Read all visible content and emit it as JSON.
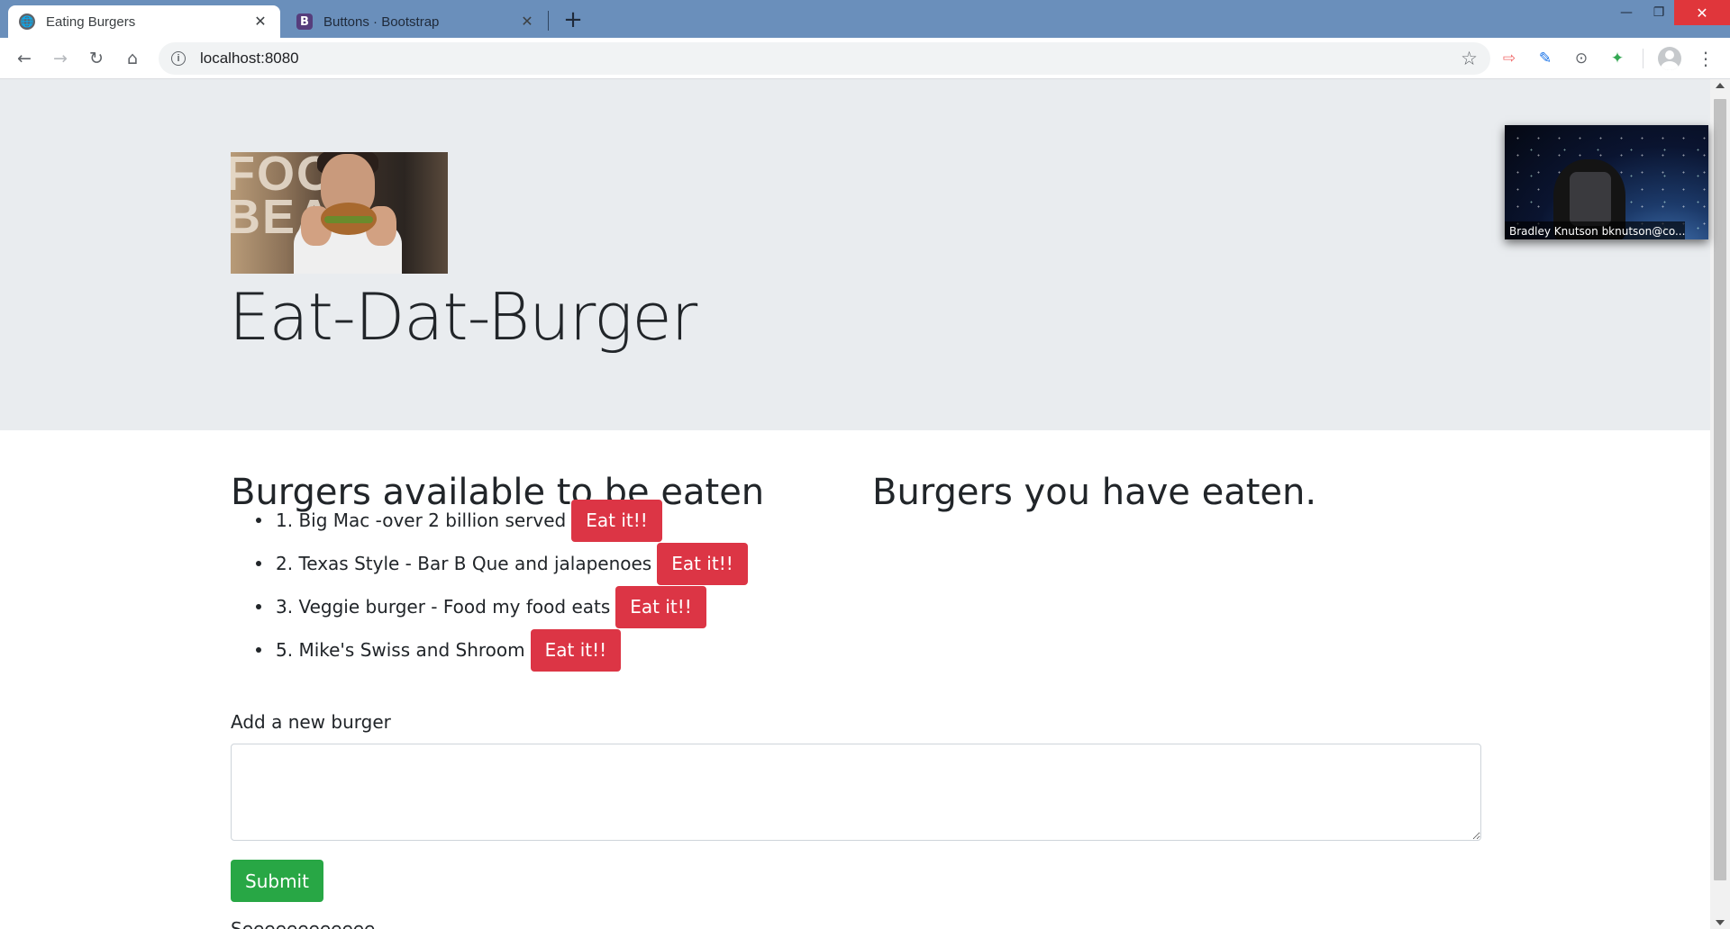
{
  "browser": {
    "tabs": [
      {
        "title": "Eating Burgers",
        "favicon": "globe-icon",
        "active": true
      },
      {
        "title": "Buttons · Bootstrap",
        "favicon": "bootstrap-icon",
        "active": false
      }
    ],
    "bootstrap_glyph": "B",
    "url": "localhost:8080"
  },
  "page": {
    "site_title": "Eat-Dat-Burger",
    "hero_letters": "FOO\nBEA",
    "available_heading": "Burgers available to be eaten",
    "eaten_heading": "Burgers you have eaten.",
    "burgers": [
      {
        "name": "1. Big Mac -over 2 billion served",
        "button": "Eat it!!"
      },
      {
        "name": "2. Texas Style - Bar B Que and jalapenoes",
        "button": "Eat it!!"
      },
      {
        "name": "3. Veggie burger - Food my food eats",
        "button": "Eat it!!"
      },
      {
        "name": "5. Mike's Swiss and Shroom",
        "button": "Eat it!!"
      }
    ],
    "form_label": "Add a new burger",
    "input_value": "",
    "submit_label": "Submit",
    "cutoff_text": "Seeeeeeeeeeee"
  },
  "video": {
    "caption": "Bradley Knutson bknutson@co..."
  },
  "colors": {
    "accent_danger": "#dc3545",
    "accent_success": "#28a745",
    "jumbotron_bg": "#e9ecef",
    "tabbar_bg": "#6a8fbb"
  }
}
